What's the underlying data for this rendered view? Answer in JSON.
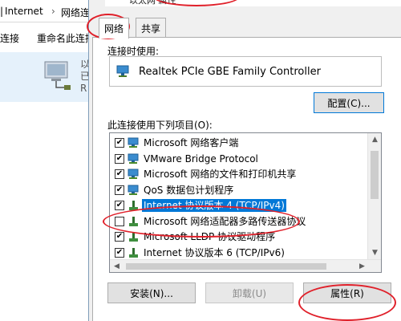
{
  "explorer": {
    "breadcrumb": [
      "Internet",
      "网络连"
    ],
    "breadcrumb_prefix": "",
    "toolbar": [
      "连接",
      "重命名此连接"
    ],
    "connection": {
      "name_fragment": "以",
      "line2": "已",
      "line3": "R"
    }
  },
  "dialog": {
    "title": "以太网 属性",
    "tabs": [
      "网络",
      "共享"
    ],
    "connect_using_label": "连接时使用:",
    "adapter_name": "Realtek PCIe GBE Family Controller",
    "configure_button": "配置(C)...",
    "items_label": "此连接使用下列项目(O):",
    "items": [
      {
        "label": "Microsoft 网络客户端",
        "checked": true,
        "icon": "network-client-icon"
      },
      {
        "label": "VMware Bridge Protocol",
        "checked": true,
        "icon": "network-client-icon"
      },
      {
        "label": "Microsoft 网络的文件和打印机共享",
        "checked": true,
        "icon": "network-client-icon"
      },
      {
        "label": "QoS 数据包计划程序",
        "checked": true,
        "icon": "network-client-icon"
      },
      {
        "label": "Internet 协议版本 4 (TCP/IPv4)",
        "checked": true,
        "selected": true,
        "icon": "protocol-icon"
      },
      {
        "label": "Microsoft 网络适配器多路传送器协议",
        "checked": false,
        "icon": "protocol-icon"
      },
      {
        "label": "Microsoft LLDP 协议驱动程序",
        "checked": true,
        "icon": "protocol-icon"
      },
      {
        "label": "Internet 协议版本 6 (TCP/IPv6)",
        "checked": true,
        "icon": "protocol-icon"
      }
    ],
    "install_button": "安装(N)...",
    "uninstall_button": "卸载(U)",
    "properties_button": "属性(R)"
  },
  "colors": {
    "selection": "#0078d7",
    "annotation": "#e0202a",
    "dialog_bg": "#f0f0f0"
  }
}
